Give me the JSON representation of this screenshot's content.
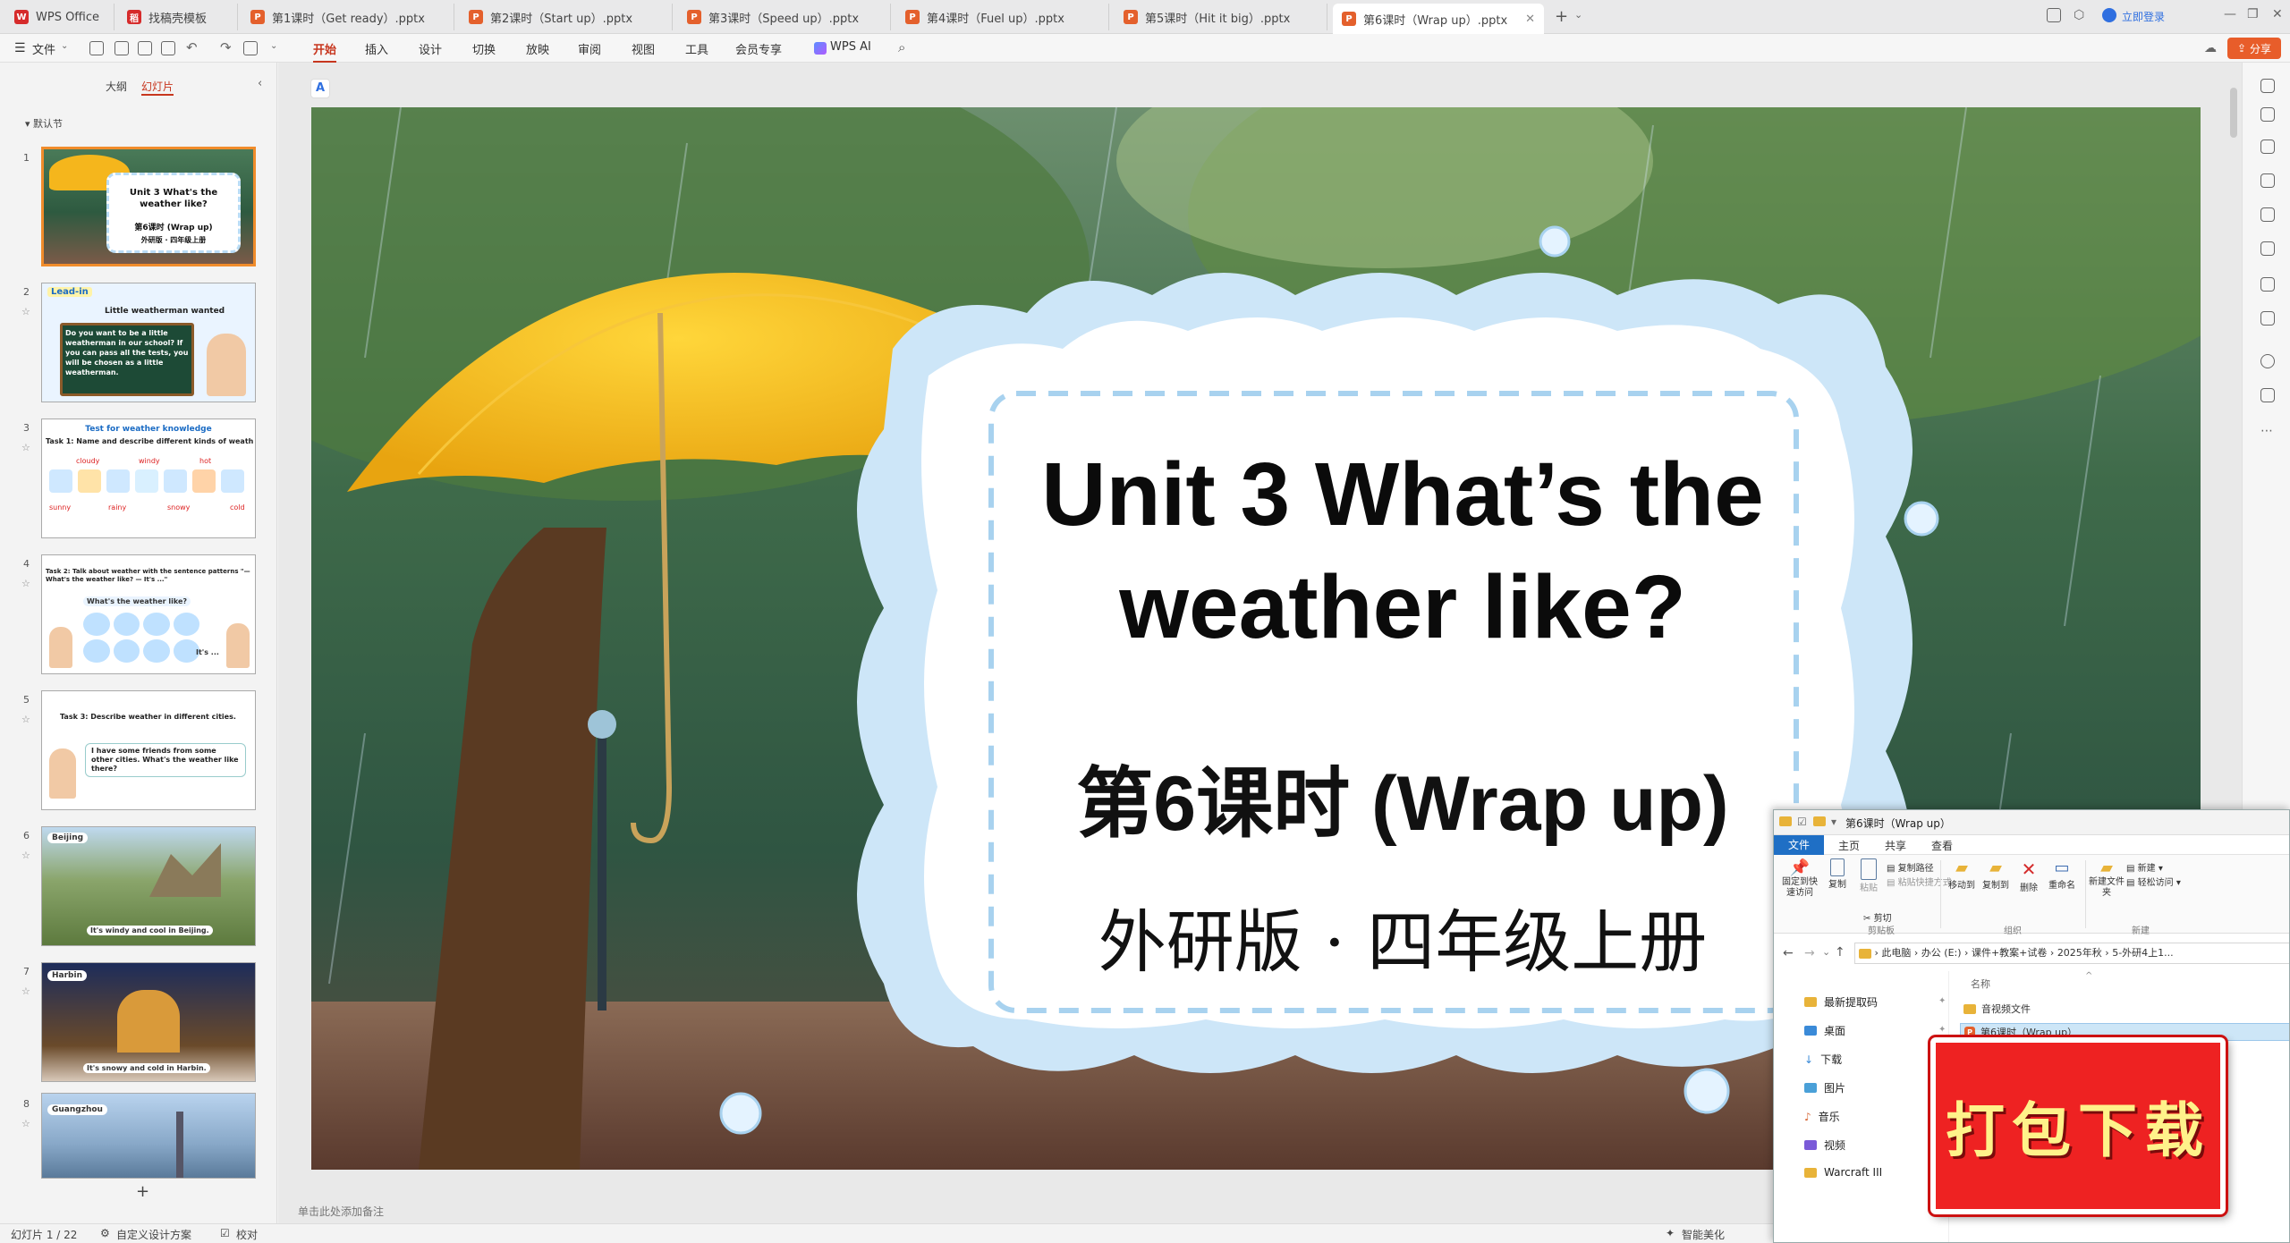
{
  "tabs": [
    {
      "label": "WPS Office",
      "icon": "wps-logo-icon"
    },
    {
      "label": "找稿壳模板",
      "icon": "template-icon"
    },
    {
      "label": "第1课时（Get ready）.pptx",
      "icon": "ppt-file-icon"
    },
    {
      "label": "第2课时（Start up）.pptx",
      "icon": "ppt-file-icon"
    },
    {
      "label": "第3课时（Speed up）.pptx",
      "icon": "ppt-file-icon"
    },
    {
      "label": "第4课时（Fuel up）.pptx",
      "icon": "ppt-file-icon"
    },
    {
      "label": "第5课时（Hit it big）.pptx",
      "icon": "ppt-file-icon"
    },
    {
      "label": "第6课时（Wrap up）.pptx",
      "icon": "ppt-file-icon",
      "active": true
    }
  ],
  "titlebar": {
    "login_label": "立即登录",
    "share_label": "分享"
  },
  "toolbar": {
    "file_label": "文件",
    "menus": [
      "开始",
      "插入",
      "设计",
      "切换",
      "放映",
      "审阅",
      "视图",
      "工具",
      "会员专享",
      "WPS AI"
    ],
    "active_menu": "开始"
  },
  "leftpane": {
    "tab_outline": "大纲",
    "tab_slides": "幻灯片",
    "section_label": "默认节",
    "add_label": "+"
  },
  "thumbs": [
    {
      "num": "1",
      "title": "Unit 3  What's the weather like?",
      "sub": "第6课时 (Wrap up)",
      "sub2": "外研版 · 四年级上册"
    },
    {
      "num": "2",
      "tag": "Lead-in",
      "heading": "Little weatherman wanted",
      "body": "Do you want to be a little weatherman in our school? If you can pass all the tests, you will be chosen as a little weatherman."
    },
    {
      "num": "3",
      "heading": "Test for weather knowledge",
      "body": "Task 1: Name and describe different kinds of weather.",
      "words_top": [
        "cloudy",
        "windy",
        "hot"
      ],
      "words_bottom": [
        "sunny",
        "rainy",
        "snowy",
        "cold"
      ]
    },
    {
      "num": "4",
      "heading": "Task 2: Talk about weather with the sentence patterns \"—What's the weather like? — It's ...\"",
      "bubble": "What's the weather like?",
      "reply": "It's ..."
    },
    {
      "num": "5",
      "heading": "Task 3: Describe weather in different cities.",
      "body": "I have some friends from some other cities. What's the weather like there?"
    },
    {
      "num": "6",
      "city": "Beijing",
      "caption": "It's windy and cool in Beijing."
    },
    {
      "num": "7",
      "city": "Harbin",
      "caption": "It's snowy and cold in Harbin."
    },
    {
      "num": "8",
      "city": "Guangzhou",
      "caption": ""
    }
  ],
  "slide": {
    "title_line1": "Unit 3  What’s the",
    "title_line2": "weather like?",
    "subtitle": "第6课时 (Wrap up)",
    "edition": "外研版 · 四年级上册"
  },
  "notes_placeholder": "单击此处添加备注",
  "status": {
    "slide_count": "幻灯片 1 / 22",
    "custom_design": "自定义设计方案",
    "proofread": "校对",
    "beautify": "智能美化"
  },
  "explorer": {
    "title": "第6课时（Wrap up）",
    "ribbon_tabs": [
      "文件",
      "主页",
      "共享",
      "查看"
    ],
    "ribbon_buttons": {
      "pin": "固定到快速访问",
      "copy": "复制",
      "paste": "粘贴",
      "copy_path": "复制路径",
      "paste_shortcut": "粘贴快捷方式",
      "cut": "剪切",
      "move_to": "移动到",
      "copy_to": "复制到",
      "delete": "删除",
      "rename": "重命名",
      "new_folder": "新建文件夹",
      "new_item": "新建",
      "easy_access": "轻松访问"
    },
    "ribbon_groups": [
      "剪贴板",
      "组织",
      "新建"
    ],
    "path": [
      "此电脑",
      "办公 (E:)",
      "课件+教案+试卷",
      "2025年秋",
      "5-外研4上1..."
    ],
    "column_name": "名称",
    "nav": [
      "最新提取码",
      "桌面",
      "下载",
      "图片",
      "音乐",
      "视频",
      "Warcraft III"
    ],
    "files": [
      "音视频文件",
      "第6课时（Wrap up）"
    ]
  },
  "download_badge": "打包下载"
}
